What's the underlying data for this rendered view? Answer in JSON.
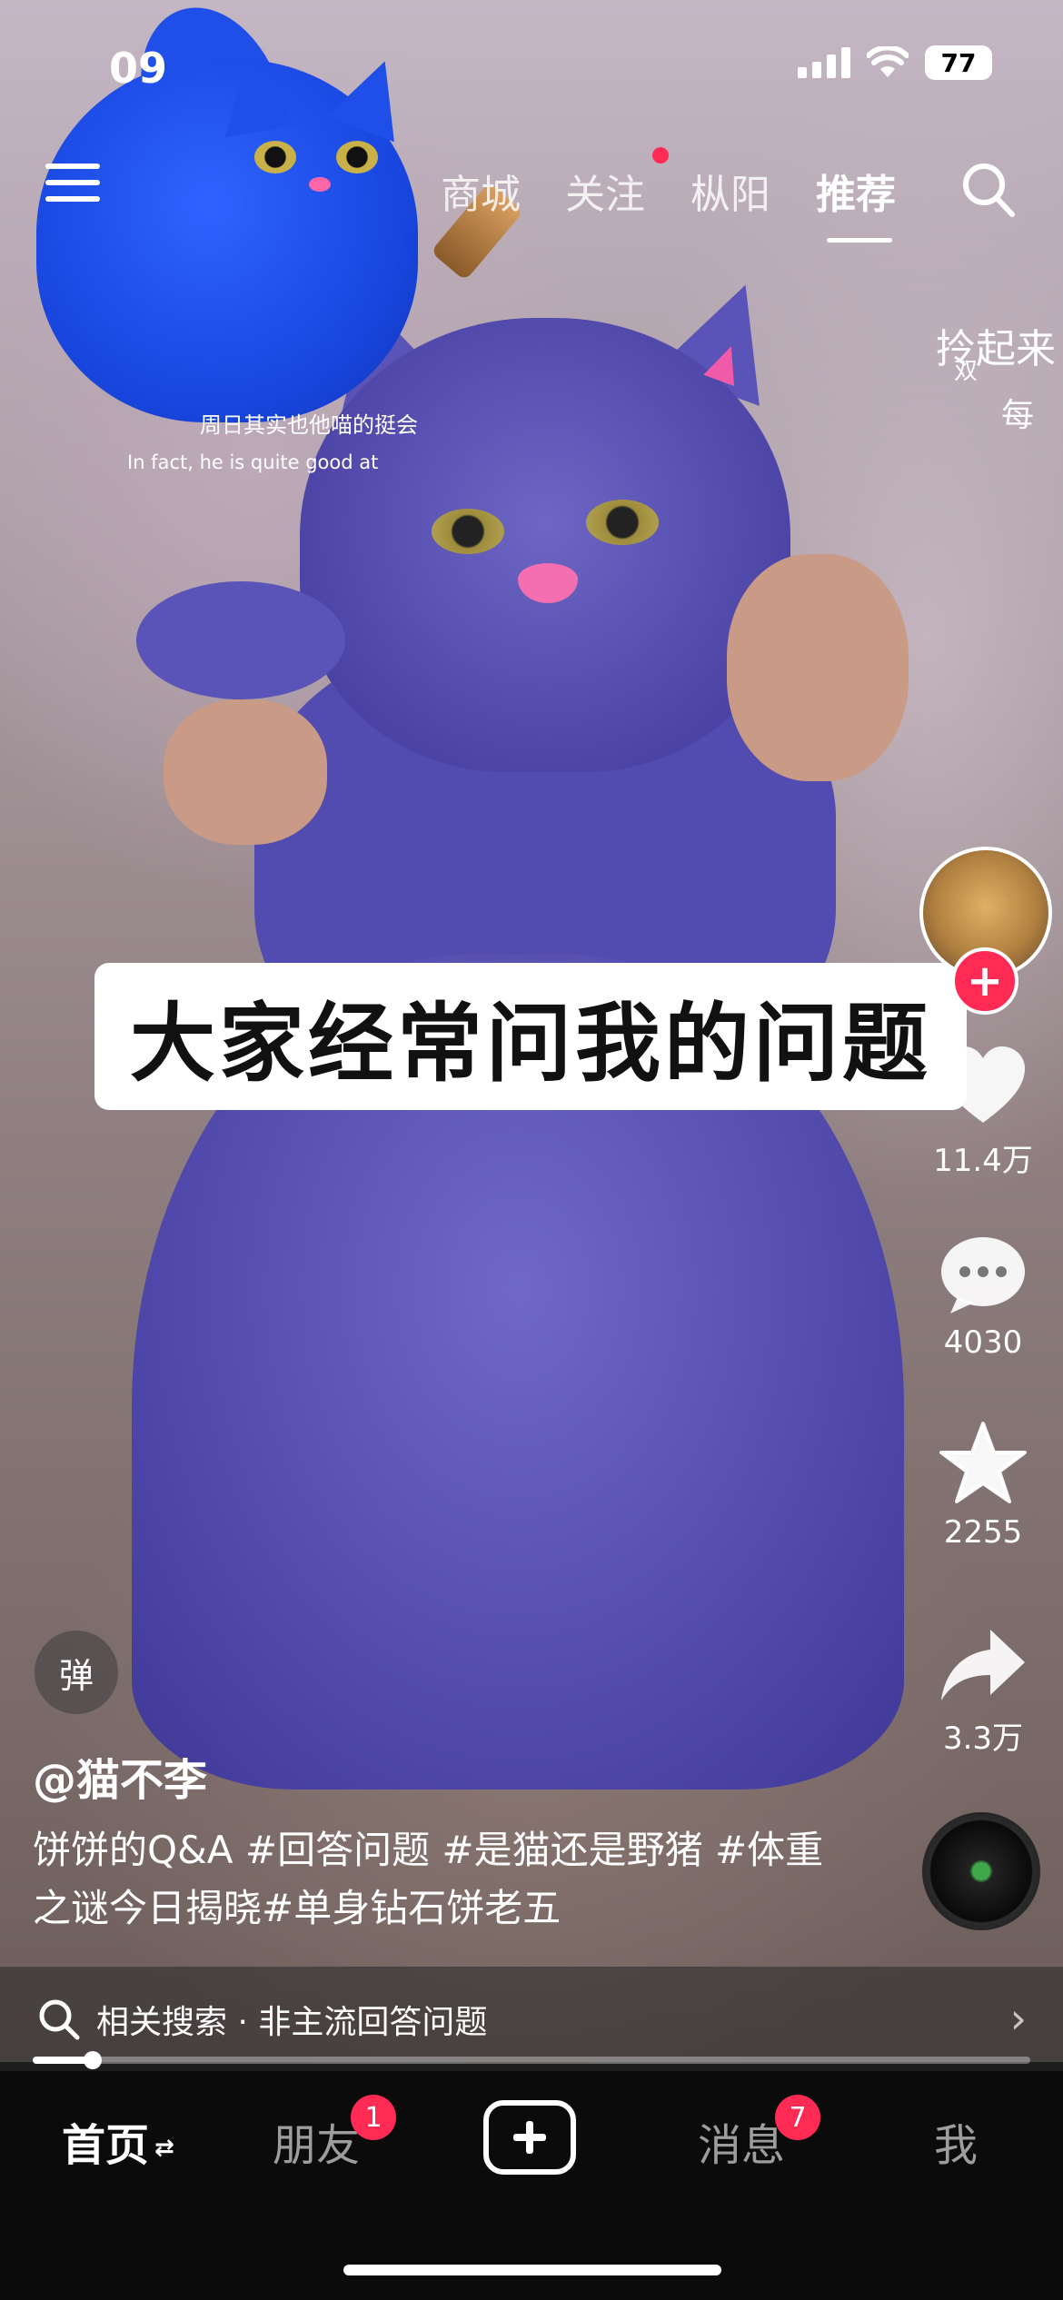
{
  "status_bar": {
    "time": "09",
    "battery": "77"
  },
  "top_nav": {
    "tabs": [
      {
        "label": "商城"
      },
      {
        "label": "关注"
      },
      {
        "label": "枞阳"
      },
      {
        "label": "推荐"
      }
    ]
  },
  "video_overlay": {
    "sticker_caption_cn": "周日其实也他喵的挺会",
    "sticker_caption_en": "In fact, he is quite good at",
    "right_overlay_a": "拎起来",
    "right_overlay_b": "双",
    "right_overlay_c": "每",
    "title_card": "大家经常问我的问题"
  },
  "right_rail": {
    "like_count": "11.4万",
    "comment_count": "4030",
    "favorite_count": "2255",
    "share_count": "3.3万"
  },
  "danmu_label": "弹",
  "author": "@猫不李",
  "description": "饼饼的Q&A #回答问题 #是猫还是野猪 #体重之谜今日揭晓#单身钻石饼老五",
  "related_search": "相关搜索 · 非主流回答问题",
  "progress": 0.06,
  "bottom_nav": {
    "home": "首页",
    "friends": "朋友",
    "friends_badge": "1",
    "messages": "消息",
    "messages_badge": "7",
    "me": "我"
  },
  "colors": {
    "accent": "#ff2b55",
    "nav_bg": "#0b0b0b"
  }
}
